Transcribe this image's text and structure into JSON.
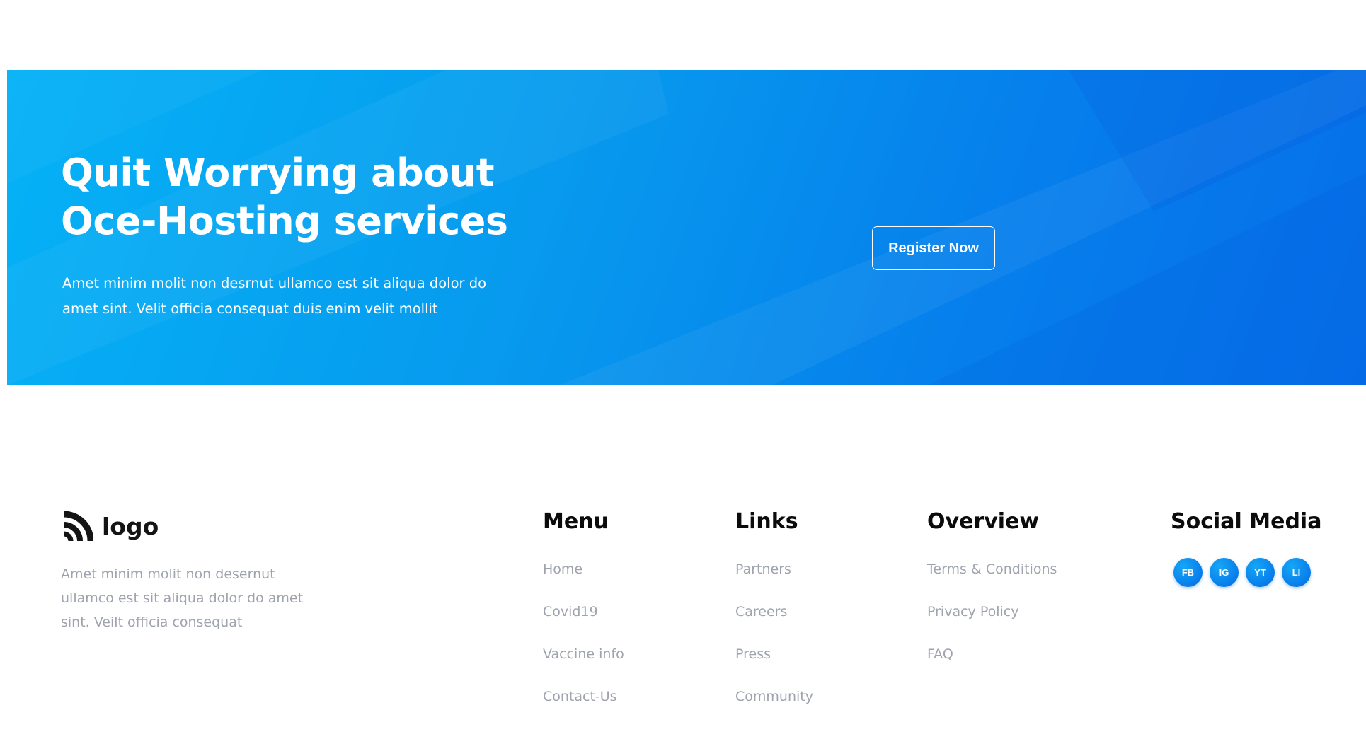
{
  "cta": {
    "title_line1": "Quit Worrying about",
    "title_line2": "Oce-Hosting services",
    "description_line1": "Amet minim molit non desrnut ullamco est sit aliqua dolor do",
    "description_line2": "amet sint. Velit officia consequat duis enim velit mollit",
    "register_label": "Register Now",
    "colors": {
      "gradient_start": "#05b2f6",
      "gradient_end": "#066ee9",
      "text": "#ffffff"
    }
  },
  "footer": {
    "brand": {
      "name": "logo",
      "icon": "logo-arcs-icon",
      "description_line1": "Amet minim molit non desernut",
      "description_line2": "ullamco est sit aliqua dolor do amet",
      "description_line3": "sint. Veilt officia consequat"
    },
    "menu": {
      "heading": "Menu",
      "items": [
        "Home",
        "Covid19",
        "Vaccine info",
        "Contact-Us"
      ]
    },
    "links": {
      "heading": "Links",
      "items": [
        "Partners",
        "Careers",
        "Press",
        "Community"
      ]
    },
    "overview": {
      "heading": "Overview",
      "items": [
        "Terms & Conditions",
        "Privacy Policy",
        "FAQ"
      ]
    },
    "social": {
      "heading": "Social Media",
      "items": [
        {
          "label": "FB",
          "icon": "facebook-icon"
        },
        {
          "label": "IG",
          "icon": "instagram-icon"
        },
        {
          "label": "YT",
          "icon": "youtube-icon"
        },
        {
          "label": "LI",
          "icon": "linkedin-icon"
        }
      ]
    },
    "colors": {
      "heading": "#0b0b0b",
      "link": "#9ea3ad",
      "social_bg": "#0a86ee"
    }
  }
}
